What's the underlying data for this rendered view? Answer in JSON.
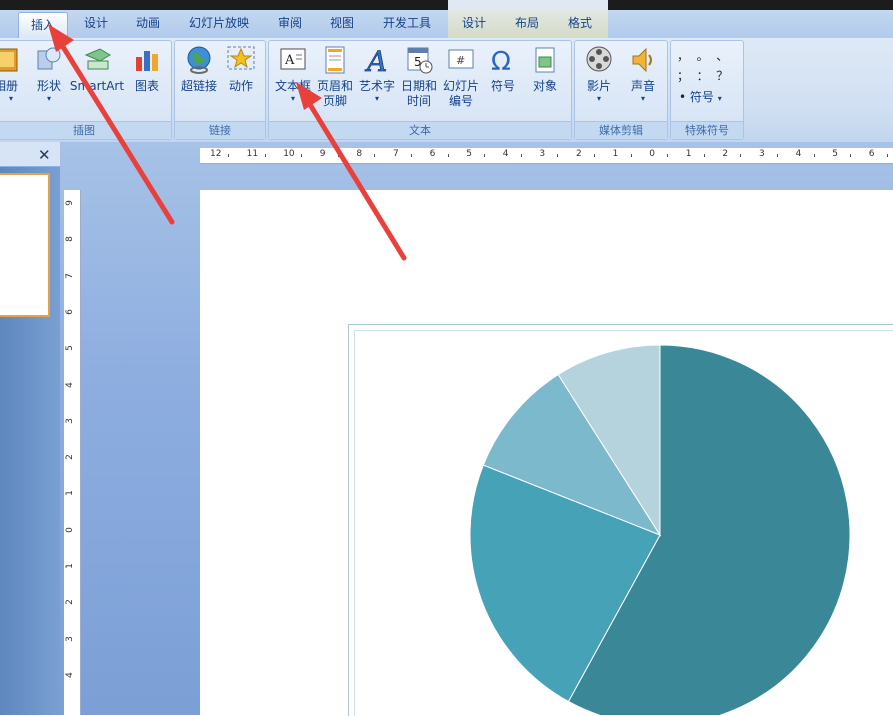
{
  "tabs": [
    {
      "label": "插入",
      "active": true
    },
    {
      "label": "设计"
    },
    {
      "label": "动画"
    },
    {
      "label": "幻灯片放映"
    },
    {
      "label": "审阅"
    },
    {
      "label": "视图"
    },
    {
      "label": "开发工具"
    },
    {
      "label": "设计"
    },
    {
      "label": "布局"
    },
    {
      "label": "格式"
    }
  ],
  "groups": {
    "illustrations": {
      "label": "插图",
      "buttons": {
        "album": "相册",
        "shapes": "形状",
        "smartart": "SmartArt",
        "chart": "图表"
      }
    },
    "links": {
      "label": "链接",
      "buttons": {
        "hyperlink": "超链接",
        "action": "动作"
      }
    },
    "text": {
      "label": "文本",
      "buttons": {
        "textbox": "文本框",
        "header_footer_1": "页眉和",
        "header_footer_2": "页脚",
        "wordart": "艺术字",
        "datetime_1": "日期和",
        "datetime_2": "时间",
        "slide_number_1": "幻灯片",
        "slide_number_2": "编号",
        "symbol": "符号",
        "object": "对象"
      }
    },
    "media": {
      "label": "媒体剪辑",
      "buttons": {
        "movie": "影片",
        "sound": "声音"
      }
    },
    "special": {
      "label": "特殊符号",
      "symbols_row1": "，  。  、",
      "symbols_row2": "；  ：  ？",
      "bullet": "•",
      "symbol_button": "符号"
    }
  },
  "panel": {
    "close": "✕"
  },
  "ruler": {
    "horizontal": [
      "12",
      "11",
      "10",
      "9",
      "8",
      "7",
      "6",
      "5",
      "4",
      "3",
      "2",
      "1",
      "0",
      "1",
      "2",
      "3",
      "4",
      "5",
      "6"
    ],
    "vertical": [
      "9",
      "8",
      "7",
      "6",
      "5",
      "4",
      "3",
      "2",
      "1",
      "0",
      "1",
      "2",
      "3",
      "4"
    ]
  },
  "colors": {
    "pie_dark": "#3a8797",
    "pie_mid": "#46a3b7",
    "pie_light": "#7cb9cc",
    "pie_lightest": "#b4d3dd",
    "arrow": "#e8413b"
  },
  "chart_data": {
    "type": "pie",
    "values": [
      58,
      23,
      10,
      9
    ],
    "categories": [
      "",
      "",
      "",
      ""
    ],
    "title": ""
  }
}
